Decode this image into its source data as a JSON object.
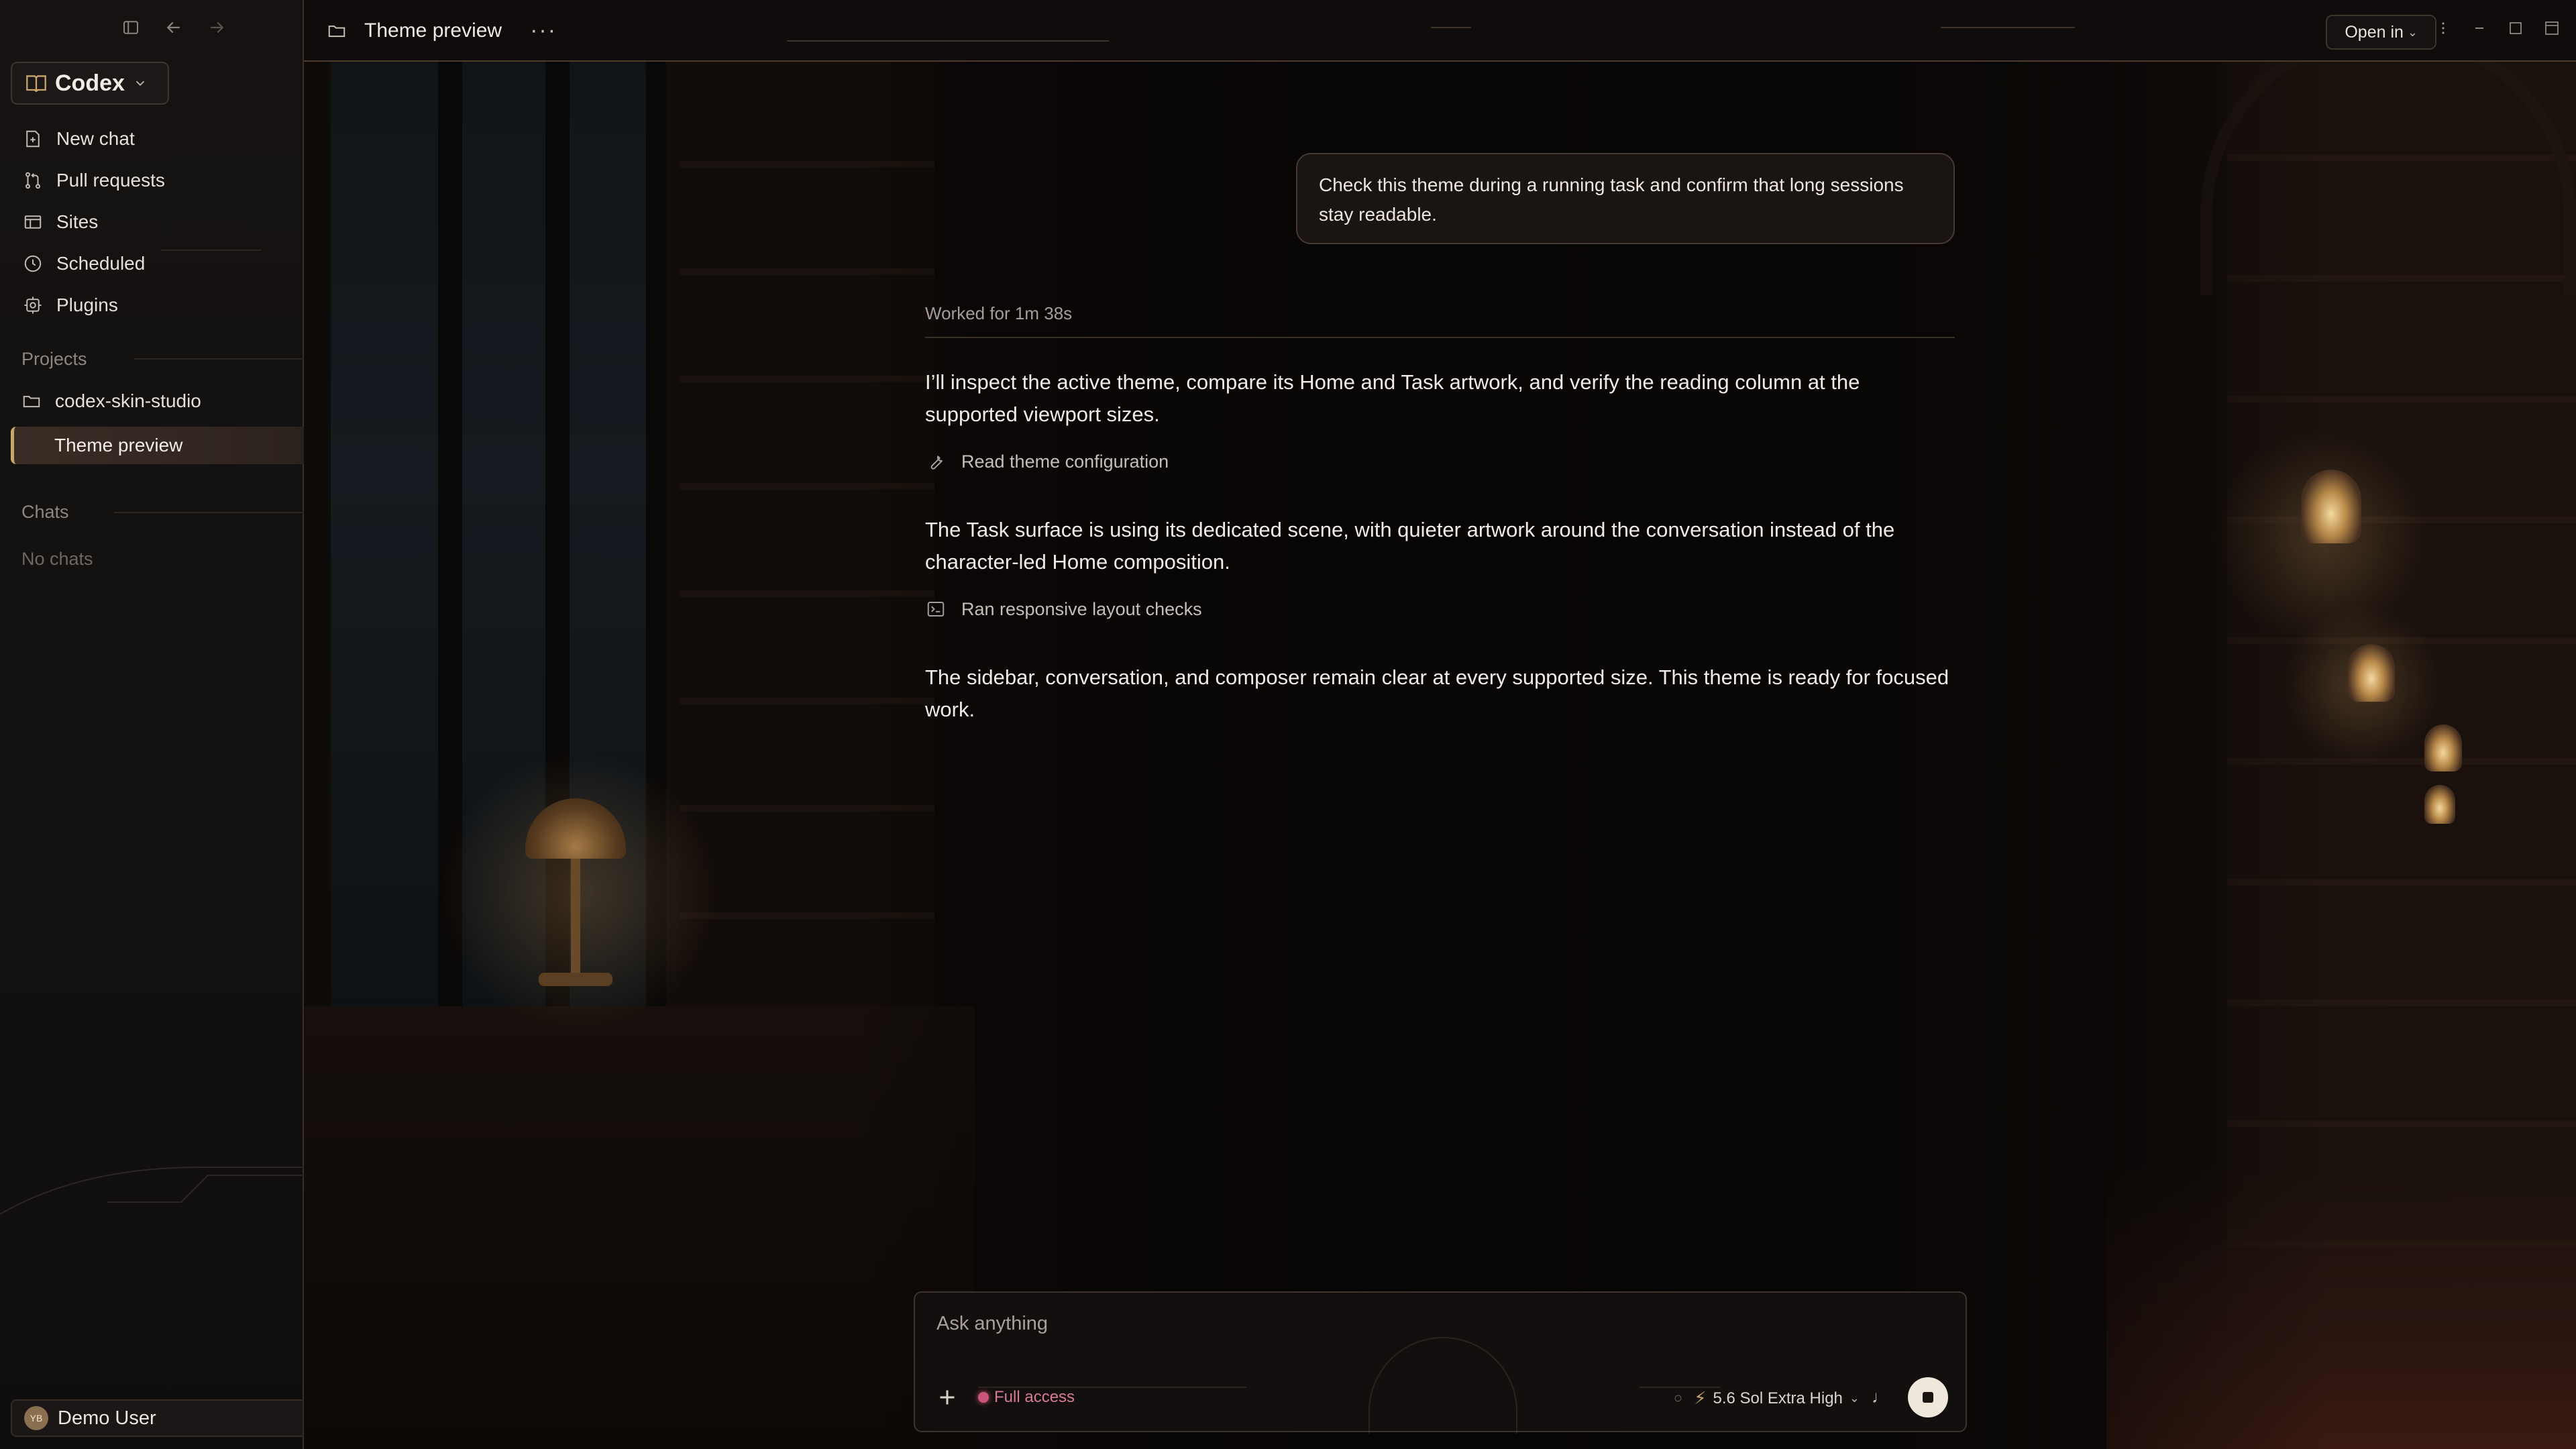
{
  "colors": {
    "accent": "#c9a56a",
    "background": "#0c0908",
    "full_access": "#d67a96",
    "stop_button": "#efe7db"
  },
  "app": {
    "name": "Codex"
  },
  "sidebar": {
    "top_icons": [
      "sidebar-toggle-icon",
      "arrow-left-icon",
      "arrow-right-icon"
    ],
    "nav": [
      {
        "label": "New chat",
        "icon": "new-chat-icon"
      },
      {
        "label": "Pull requests",
        "icon": "pull-request-icon"
      },
      {
        "label": "Sites",
        "icon": "sites-icon"
      },
      {
        "label": "Scheduled",
        "icon": "clock-icon"
      },
      {
        "label": "Plugins",
        "icon": "plugin-icon"
      }
    ],
    "projects_title": "Projects",
    "projects": [
      {
        "label": "codex-skin-studio",
        "icon": "folder-icon"
      }
    ],
    "active_item": "Theme preview",
    "chats_title": "Chats",
    "chats_empty": "No chats",
    "user": {
      "name": "Demo User",
      "initials": "YB"
    }
  },
  "topbar": {
    "title": "Theme preview",
    "more": "···",
    "open_in": "Open in"
  },
  "conversation": {
    "user_message": "Check this theme during a running task and confirm that long sessions stay readable.",
    "worked_for": "Worked for 1m 38s",
    "para1": "I’ll inspect the active theme, compare its Home and Task artwork, and verify the reading column at the supported viewport sizes.",
    "tool1": "Read theme configuration",
    "para2": "The Task surface is using its dedicated scene, with quieter artwork around the conversation instead of the character-led Home composition.",
    "tool2": "Ran responsive layout checks",
    "para3": "The sidebar, conversation, and composer remain clear at every supported size. This theme is ready for focused work."
  },
  "composer": {
    "placeholder": "Ask anything",
    "access": "Full access",
    "model": "5.6 Sol Extra High"
  }
}
